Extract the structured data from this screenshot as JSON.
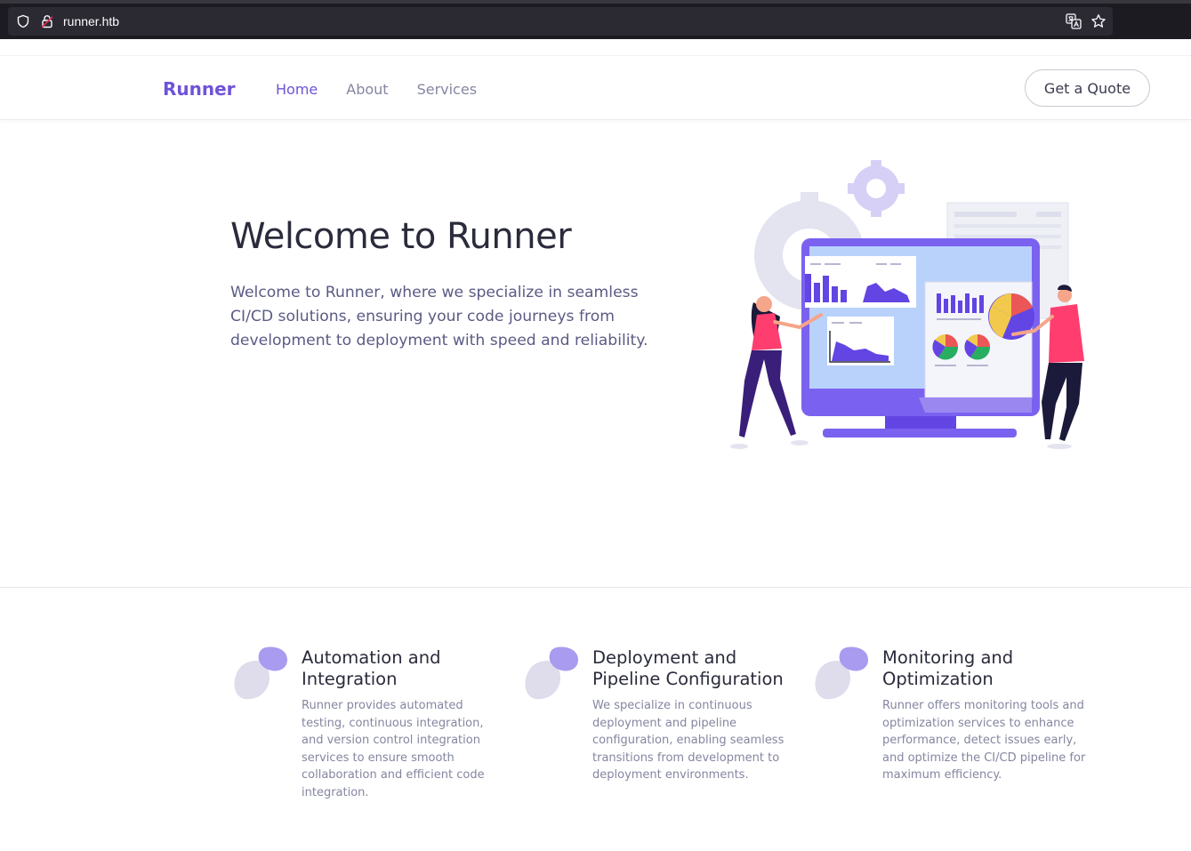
{
  "browser": {
    "url": "runner.htb"
  },
  "header": {
    "logo": "Runner",
    "nav": [
      {
        "label": "Home",
        "active": true
      },
      {
        "label": "About",
        "active": false
      },
      {
        "label": "Services",
        "active": false
      }
    ],
    "cta_label": "Get a Quote"
  },
  "hero": {
    "title": "Welcome to Runner",
    "text": "Welcome to Runner, where we specialize in seamless CI/CD solutions, ensuring your code journeys from development to deployment with speed and reliability."
  },
  "features": [
    {
      "title": "Automation and Integration",
      "text": "Runner provides automated testing, continuous integration, and version control integration services to ensure smooth collaboration and efficient code integration."
    },
    {
      "title": "Deployment and Pipeline Configuration",
      "text": "We specialize in continuous deployment and pipeline configuration, enabling seamless transitions from development to deployment environments."
    },
    {
      "title": "Monitoring and Optimization",
      "text": "Runner offers monitoring tools and optimization services to enhance performance, detect issues early, and optimize the CI/CD pipeline for maximum efficiency."
    }
  ],
  "colors": {
    "accent": "#6f52d9",
    "blob_dark": "#a99bf0",
    "blob_light": "#dfdcec"
  },
  "icons": {
    "shield": "shield-icon",
    "lock": "lock-icon",
    "translate": "translate-icon",
    "star": "bookmark-star-icon"
  }
}
